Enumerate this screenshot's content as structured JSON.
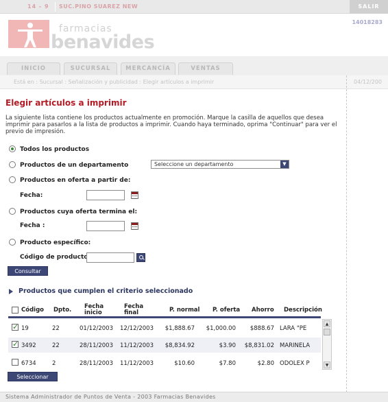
{
  "topbar": {
    "code": "14 - 9",
    "branch": "SUC.PINO SUAREZ NEW",
    "logout_label": "SALIR"
  },
  "header": {
    "logo_line1": "farmacias",
    "logo_line2": "benavides",
    "user_id": "14018283"
  },
  "nav": {
    "tabs": [
      "INICIO",
      "SUCURSAL",
      "MERCANCÍA",
      "VENTAS"
    ]
  },
  "breadcrumb": "Está en : Sucursal : Señalización y publicidad : Elegir artículos a imprimir",
  "date": "04/12/200",
  "page": {
    "title": "Elegir artículos a imprimir",
    "intro": "La siguiente lista contiene los productos actualmente en promoción. Marque la casilla de aquellos que desea imprimir para pasarlos a la lista de productos a imprimir. Cuando haya terminado, oprima \"Continuar\" para ver el previo de impresión."
  },
  "filters": {
    "all_products": "Todos los productos",
    "department": "Productos de un departamento",
    "department_select": "Seleccione un departamento",
    "offer_from": "Productos en oferta a partir de:",
    "date_label1": "Fecha:",
    "offer_ends": "Productos cuya oferta termina el:",
    "date_label2": "Fecha :",
    "specific": "Producto específico:",
    "product_code": "Código de producto",
    "consult_button": "Consultar"
  },
  "results": {
    "title": "Productos que cumplen el criterio seleccionado",
    "headers": {
      "code": "Código",
      "dept": "Dpto.",
      "start": "Fecha inicio",
      "end": "Fecha final",
      "normal": "P. normal",
      "offer": "P. oferta",
      "saving": "Ahorro",
      "desc": "Descripción"
    },
    "rows": [
      {
        "code": "19",
        "dept": "22",
        "start": "01/12/2003",
        "end": "12/12/2003",
        "normal": "$1,888.67",
        "offer": "$1,000.00",
        "saving": "$888.67",
        "desc": "LARA \"PE",
        "checked": true
      },
      {
        "code": "3492",
        "dept": "22",
        "start": "28/11/2003",
        "end": "11/12/2003",
        "normal": "$8,834.92",
        "offer": "$3.90",
        "saving": "$8,831.02",
        "desc": "MARINELA",
        "checked": true
      },
      {
        "code": "6734",
        "dept": "2",
        "start": "28/11/2003",
        "end": "11/12/2003",
        "normal": "$10.60",
        "offer": "$7.80",
        "saving": "$2.80",
        "desc": "ODOLEX P",
        "checked": false
      }
    ],
    "select_button": "Seleccionar"
  },
  "footer": "Sistema Administrador de Puntos de Venta - 2003 Farmacias Benavides"
}
